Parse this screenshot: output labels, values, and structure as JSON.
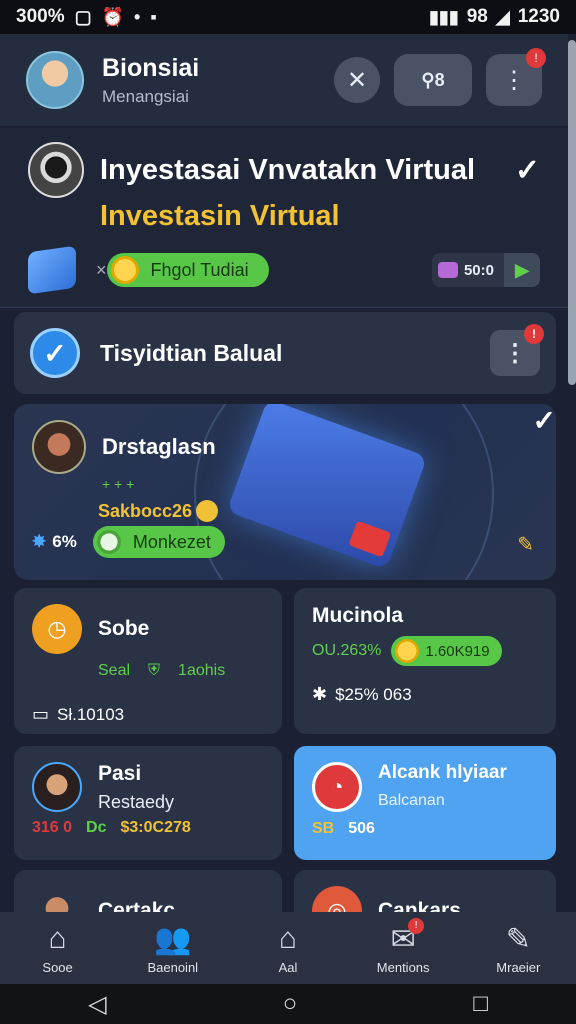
{
  "status_bar": {
    "time_left": "300%",
    "time_right": "1230",
    "signal_text": "98"
  },
  "header": {
    "title": "Bionsiai",
    "subtitle": "Menangsiai",
    "search_badge": "8",
    "notif_count": "!"
  },
  "invest_card": {
    "title": "Inyestasai Vnvatakn Virtual",
    "subtitle": "Investasin Virtual",
    "pill_label": "Fhgol Tudiai",
    "stat_value": "50:0"
  },
  "transaction": {
    "title": "Tisyidtian Balual",
    "badge": "!"
  },
  "feature": {
    "title": "Drstaglasn",
    "meta": "+ + +",
    "amount": "Sakbocc26",
    "percent": "6%",
    "pill_label": "Monkezet"
  },
  "tiles": [
    {
      "title": "Sobe",
      "line_left": "Seal",
      "line_right": "1aohis",
      "foot": "Sł.10103",
      "accent": "#f0a020"
    },
    {
      "title": "Mucinola",
      "line_left": "OU.263%",
      "pill": "1.60K919",
      "foot": "$25% 063",
      "accent": "#5fd04a"
    },
    {
      "title": "Pasi",
      "subtitle": "Restaedy",
      "left_val": "316 0",
      "mid_val": "Dc",
      "right_val": "$3:0C278",
      "accent": "#e0393b"
    },
    {
      "title": "Alcank hlyiaar",
      "subtitle": "Balcanan",
      "left_val": "SB",
      "right_val": "506",
      "accent": "#4aa8ff"
    },
    {
      "title": "Certakc"
    },
    {
      "title": "Cankars"
    }
  ],
  "bottom_nav": [
    {
      "label": "Sooe",
      "icon": "home-icon"
    },
    {
      "label": "Baenoinl",
      "icon": "people-icon"
    },
    {
      "label": "Aal",
      "icon": "house-icon"
    },
    {
      "label": "Mentions",
      "icon": "mentions-icon",
      "badge": "!"
    },
    {
      "label": "Mraeier",
      "icon": "edit-icon"
    }
  ]
}
